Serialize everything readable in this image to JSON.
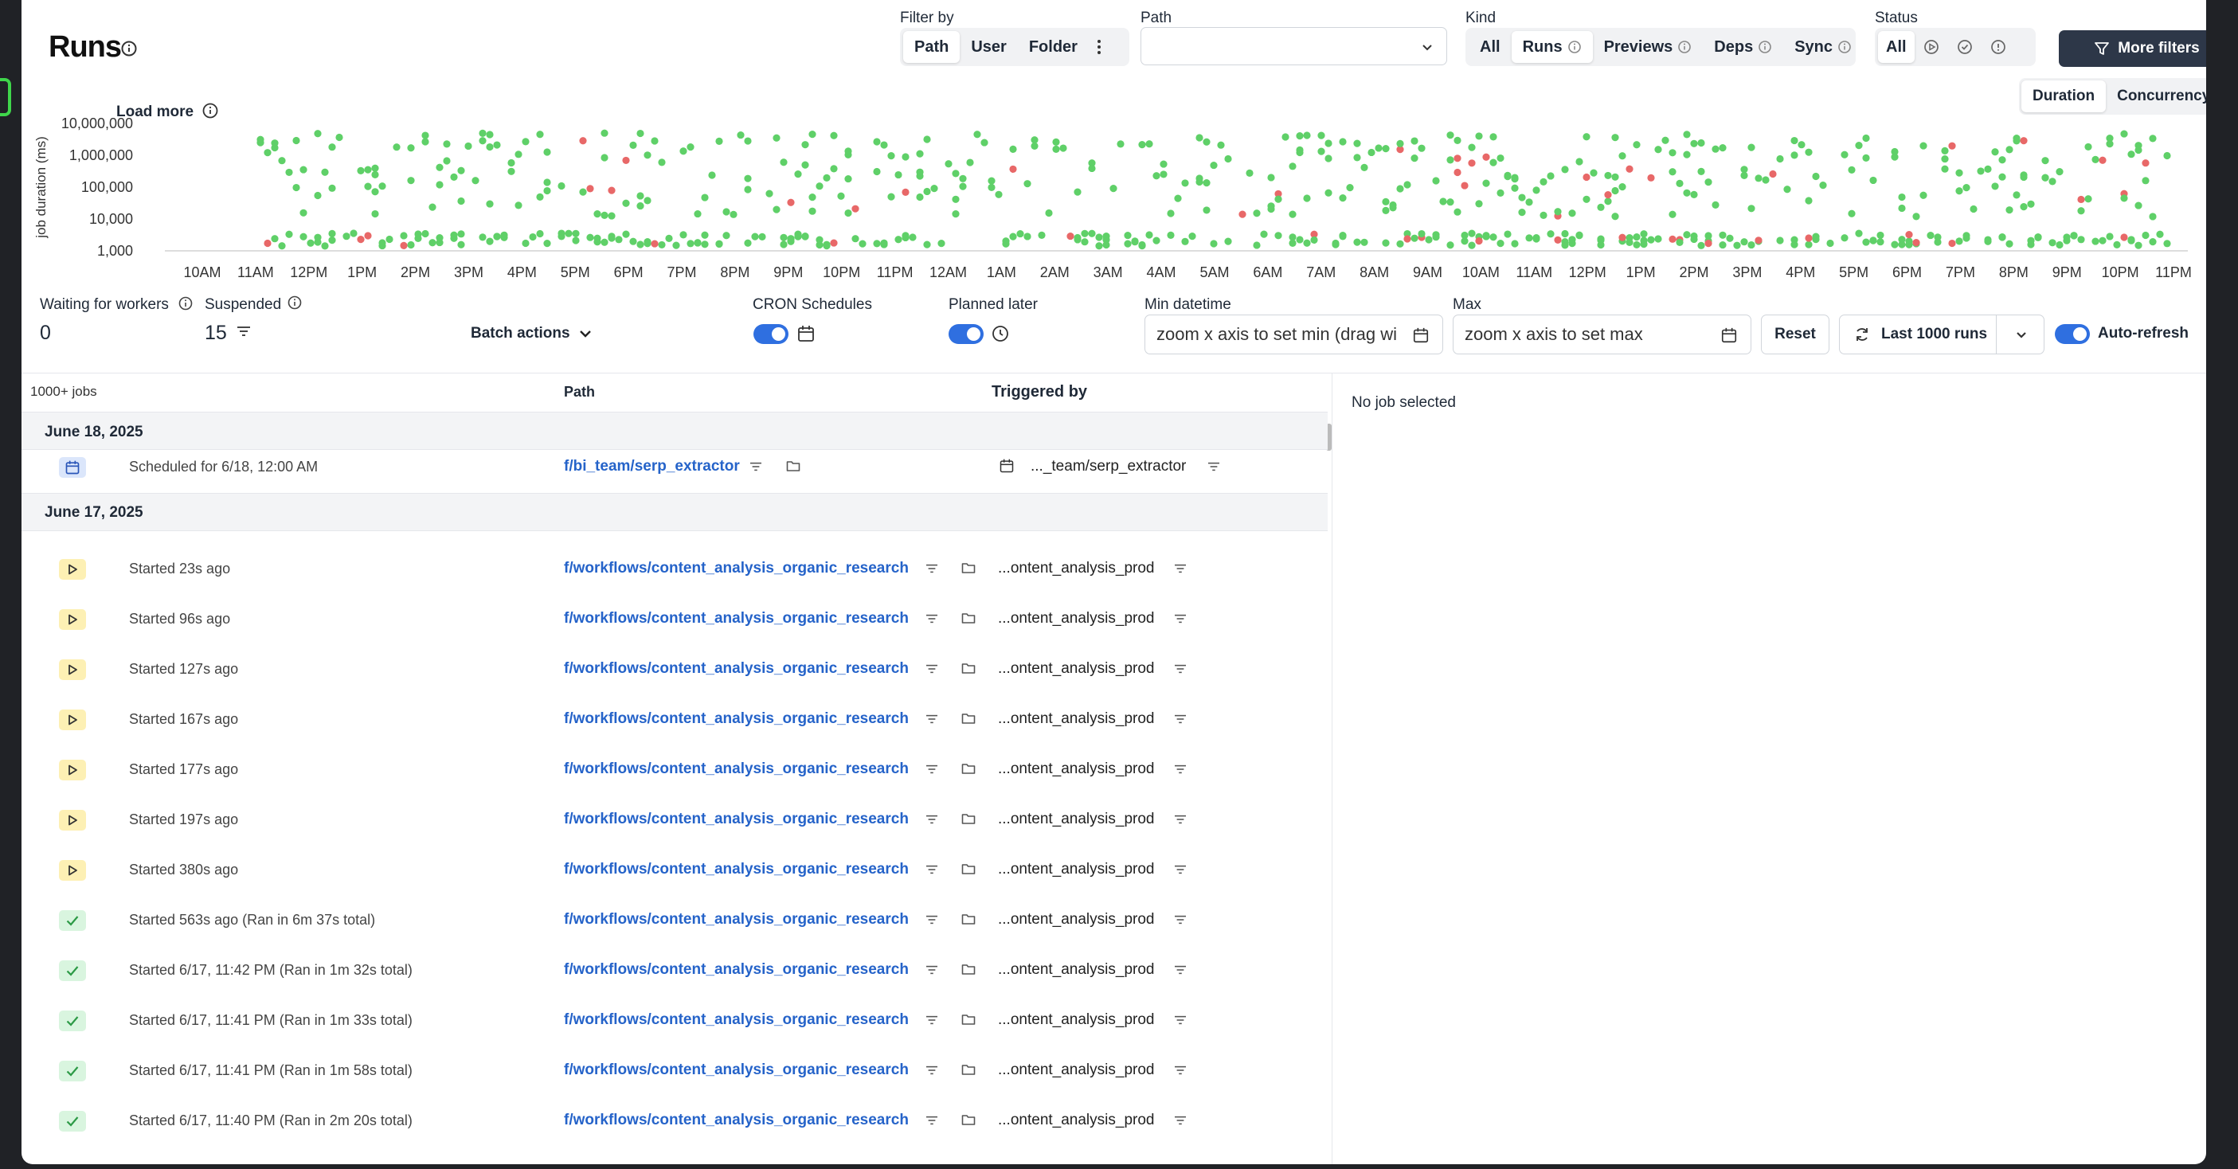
{
  "header": {
    "title": "Runs"
  },
  "filter_by": {
    "label": "Filter by",
    "options": [
      "Path",
      "User",
      "Folder"
    ],
    "selected": "Path"
  },
  "path_filter": {
    "label": "Path",
    "value": ""
  },
  "kind": {
    "label": "Kind",
    "options": [
      "All",
      "Runs",
      "Previews",
      "Deps",
      "Sync"
    ],
    "selected": "Runs"
  },
  "status": {
    "label": "Status",
    "selected": "All"
  },
  "more_filters": "More filters",
  "chart_toggle": {
    "options": [
      "Duration",
      "Concurrency"
    ],
    "selected": "Duration"
  },
  "load_more": "Load more",
  "chart_data": {
    "type": "scatter",
    "ylabel": "job duration (ms)",
    "yscale": "log",
    "yticks": [
      "10,000,000",
      "1,000,000",
      "100,000",
      "10,000",
      "1,000"
    ],
    "xticks": [
      "10AM",
      "11AM",
      "12PM",
      "1PM",
      "2PM",
      "3PM",
      "4PM",
      "5PM",
      "6PM",
      "7PM",
      "8PM",
      "9PM",
      "10PM",
      "11PM",
      "12AM",
      "1AM",
      "2AM",
      "3AM",
      "4AM",
      "5AM",
      "6AM",
      "7AM",
      "8AM",
      "9AM",
      "10AM",
      "11AM",
      "12PM",
      "1PM",
      "2PM",
      "3PM",
      "4PM",
      "5PM",
      "6PM",
      "7PM",
      "8PM",
      "9PM",
      "10PM",
      "11PM"
    ],
    "series": [
      {
        "color": "#5fd068"
      },
      {
        "color": "#e86868"
      }
    ],
    "grid": false
  },
  "counters": {
    "waiting_label": "Waiting for workers",
    "waiting_value": "0",
    "suspended_label": "Suspended",
    "suspended_value": "15"
  },
  "batch_actions": "Batch actions",
  "cron_label": "CRON Schedules",
  "planned_label": "Planned later",
  "min_datetime": {
    "label": "Min datetime",
    "placeholder": "zoom x axis to set min (drag wi"
  },
  "max_datetime": {
    "label": "Max",
    "placeholder": "zoom x axis to set max"
  },
  "reset": "Reset",
  "last_runs": "Last 1000 runs",
  "auto_refresh": "Auto-refresh",
  "table": {
    "count": "1000+ jobs",
    "col_path": "Path",
    "col_trigger": "Triggered by"
  },
  "groups": [
    {
      "date": "June 18, 2025"
    },
    {
      "date": "June 17, 2025"
    }
  ],
  "scheduled_row": {
    "status": "Scheduled for 6/18, 12:00 AM",
    "path": "f/bi_team/serp_extractor",
    "trigger": "..._team/serp_extractor"
  },
  "rows": [
    {
      "state": "running",
      "status": "Started 23s ago",
      "path": "f/workflows/content_analysis_organic_research",
      "trigger": "...ontent_analysis_prod"
    },
    {
      "state": "running",
      "status": "Started 96s ago",
      "path": "f/workflows/content_analysis_organic_research",
      "trigger": "...ontent_analysis_prod"
    },
    {
      "state": "running",
      "status": "Started 127s ago",
      "path": "f/workflows/content_analysis_organic_research",
      "trigger": "...ontent_analysis_prod"
    },
    {
      "state": "running",
      "status": "Started 167s ago",
      "path": "f/workflows/content_analysis_organic_research",
      "trigger": "...ontent_analysis_prod"
    },
    {
      "state": "running",
      "status": "Started 177s ago",
      "path": "f/workflows/content_analysis_organic_research",
      "trigger": "...ontent_analysis_prod"
    },
    {
      "state": "running",
      "status": "Started 197s ago",
      "path": "f/workflows/content_analysis_organic_research",
      "trigger": "...ontent_analysis_prod"
    },
    {
      "state": "running",
      "status": "Started 380s ago",
      "path": "f/workflows/content_analysis_organic_research",
      "trigger": "...ontent_analysis_prod"
    },
    {
      "state": "success",
      "status": "Started 563s ago (Ran in 6m 37s total)",
      "path": "f/workflows/content_analysis_organic_research",
      "trigger": "...ontent_analysis_prod"
    },
    {
      "state": "success",
      "status": "Started 6/17, 11:42 PM (Ran in 1m 32s total)",
      "path": "f/workflows/content_analysis_organic_research",
      "trigger": "...ontent_analysis_prod"
    },
    {
      "state": "success",
      "status": "Started 6/17, 11:41 PM (Ran in 1m 33s total)",
      "path": "f/workflows/content_analysis_organic_research",
      "trigger": "...ontent_analysis_prod"
    },
    {
      "state": "success",
      "status": "Started 6/17, 11:41 PM (Ran in 1m 58s total)",
      "path": "f/workflows/content_analysis_organic_research",
      "trigger": "...ontent_analysis_prod"
    },
    {
      "state": "success",
      "status": "Started 6/17, 11:40 PM (Ran in 2m 20s total)",
      "path": "f/workflows/content_analysis_organic_research",
      "trigger": "...ontent_analysis_prod"
    }
  ],
  "detail": {
    "empty": "No job selected"
  }
}
